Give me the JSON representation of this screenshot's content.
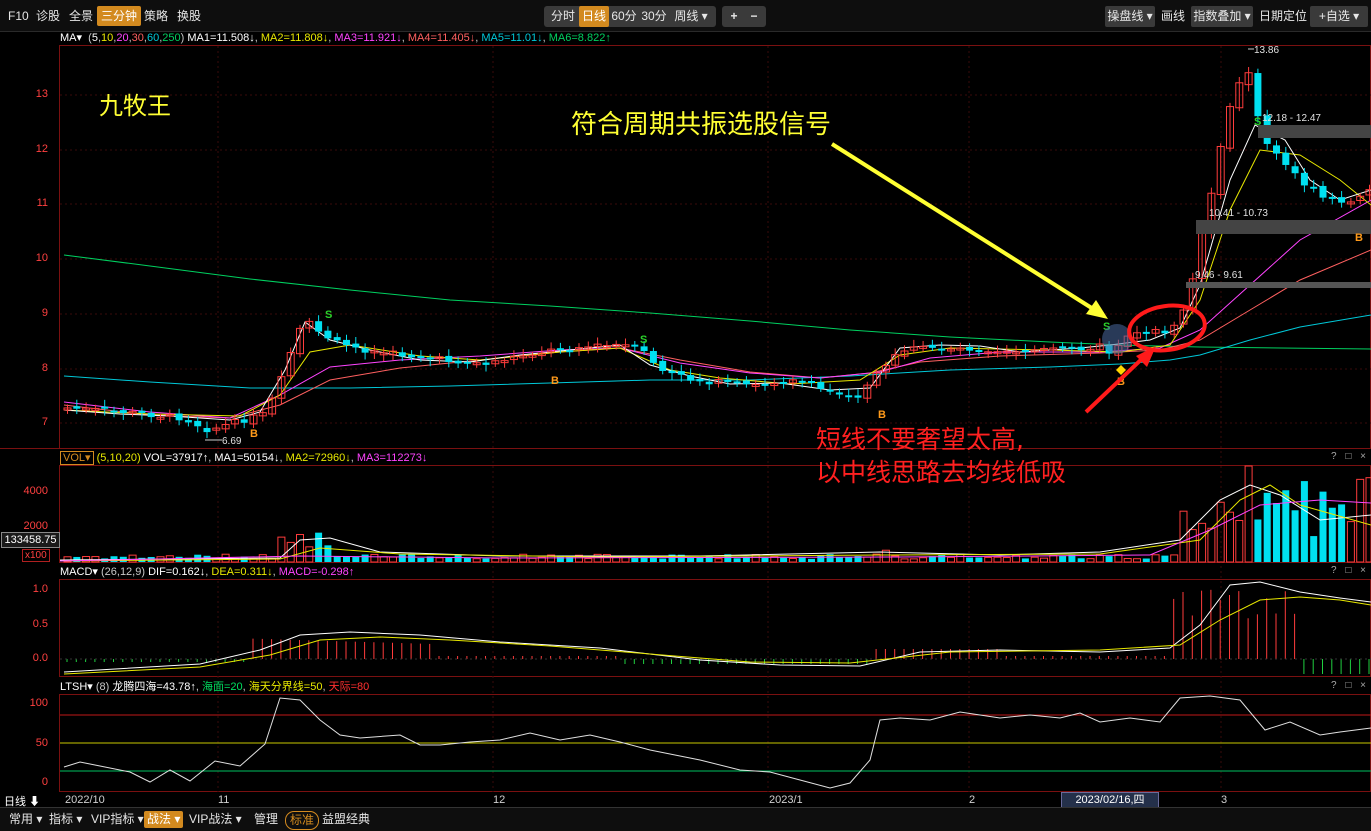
{
  "toolbar": {
    "f10": "F10",
    "zhengu": "诊股",
    "quanjing": "全景",
    "sanfenzhong": "三分钟",
    "celue": "策略",
    "huangu": "换股",
    "periods": [
      "分时",
      "日线",
      "60分",
      "30分",
      "周线 ▾"
    ],
    "plus": "+",
    "minus": "−",
    "caopan": "操盘线 ▾",
    "huaxian": "画线",
    "zhishu": "指数叠加 ▾",
    "riqi": "日期定位",
    "zixuan": "+自选 ▾"
  },
  "stock_name": "九牧王",
  "annotations": {
    "signal": "符合周期共振选股信号",
    "advice_line1": "短线不要奢望太高,",
    "advice_line2": "以中线思路去均线低吸"
  },
  "ma_header": {
    "name": "MA▾",
    "params_open": "(",
    "params": [
      "5",
      "10",
      "20",
      "30",
      "60",
      "250"
    ],
    "params_close": ")",
    "ma1": "MA1=11.508↓",
    "ma2": "MA2=11.808↓",
    "ma3": "MA3=11.921↓",
    "ma4": "MA4=11.405↓",
    "ma5": "MA5=11.01↓",
    "ma6": "MA6=8.822↑"
  },
  "vol_header": {
    "name": "VOL▾",
    "params": "(5,10,20)",
    "vol": "VOL=37917↑",
    "ma1": "MA1=50154↓",
    "ma2": "MA2=72960↓",
    "ma3": "MA3=112273↓"
  },
  "macd_header": {
    "name": "MACD▾",
    "params": "(26,12,9)",
    "dif": "DIF=0.162↓",
    "dea": "DEA=0.311↓",
    "macd": "MACD=-0.298↑"
  },
  "ltsh_header": {
    "name": "LTSH▾",
    "params": "(8)",
    "val": "龙腾四海=43.78↑",
    "sea": "海面=20",
    "sky_line": "海天分界线=50",
    "sky": "天际=80"
  },
  "panel_ctrl": "? □ ×",
  "price_axis": [
    "13",
    "12",
    "11",
    "10",
    "9",
    "8",
    "7"
  ],
  "vol_axis": [
    "4000",
    "2000"
  ],
  "vol_current": "133458.75",
  "vol_unit": "x100",
  "macd_axis": [
    "1.0",
    "0.5",
    "0.0"
  ],
  "ltsh_axis": [
    "100",
    "50",
    "0"
  ],
  "x_axis": [
    "2022/10",
    "11",
    "12",
    "2023/1",
    "2",
    "3"
  ],
  "x_highlight": "2023/02/16,四",
  "period_indicator": "日线 ⬇",
  "price_labels": {
    "high": "13.86",
    "low": "6.69",
    "zone1": "12.18 - 12.47",
    "zone2": "10.41 - 10.73",
    "zone3": "9.46 - 9.61"
  },
  "signal_marks": {
    "sell": "S",
    "buy": "B"
  },
  "bottom": {
    "changyong": "常用 ▾",
    "zhibiao": "指标 ▾",
    "vip": "VIP指标 ▾",
    "zhanfa": "战法 ▾",
    "vipzhanfa": "VIP战法 ▾",
    "guanli": "管理",
    "biaozhun": "标准",
    "yimeng": "益盟经典"
  },
  "colors": {
    "up": "#ff3c3c",
    "down": "#00e0f0",
    "ma1": "#ffffff",
    "ma2": "#e8e800",
    "ma3": "#ff44ff",
    "ma4": "#ff6060",
    "ma5": "#00c8d8",
    "ma6": "#00d060",
    "accent": "#d38a1f"
  }
}
